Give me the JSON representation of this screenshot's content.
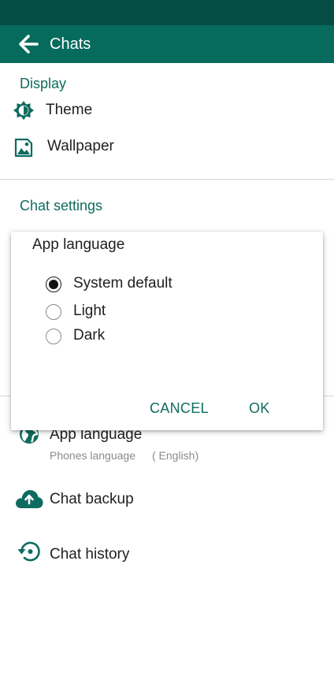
{
  "colors": {
    "accent": "#0e6b5f",
    "status_bar": "#054d44",
    "app_bar": "#066b5d"
  },
  "app_bar": {
    "title": "Chats",
    "back_icon": "arrow-left-icon"
  },
  "display_section": {
    "header": "Display",
    "items": [
      {
        "label": "Theme",
        "icon": "brightness-gear-icon"
      },
      {
        "label": "Wallpaper",
        "icon": "image-icon"
      }
    ]
  },
  "chat_settings_section": {
    "header": "Chat settings"
  },
  "dialog": {
    "title": "App language",
    "options": [
      {
        "label": "System default",
        "selected": true
      },
      {
        "label": "Light",
        "selected": false
      },
      {
        "label": "Dark",
        "selected": false
      }
    ],
    "cancel_label": "CANCEL",
    "ok_label": "OK"
  },
  "settings_items": [
    {
      "label": "App language",
      "sub_label": "Phones language",
      "sub_value": "( English)",
      "icon": "globe-icon"
    },
    {
      "label": "Chat backup",
      "icon": "cloud-upload-icon"
    },
    {
      "label": "Chat history",
      "icon": "history-icon"
    }
  ]
}
